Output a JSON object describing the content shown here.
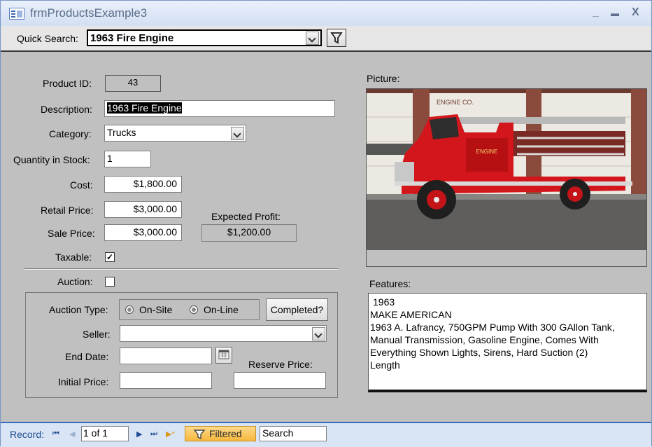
{
  "window": {
    "title": "frmProductsExample3",
    "minimize": "_",
    "maximize": "▬",
    "close": "X"
  },
  "quick_search": {
    "label": "Quick Search:",
    "value": "1963 Fire Engine"
  },
  "form": {
    "product_id": {
      "label": "Product ID:",
      "value": "43"
    },
    "description": {
      "label": "Description:",
      "value": "1963 Fire Engine"
    },
    "category": {
      "label": "Category:",
      "value": "Trucks"
    },
    "quantity": {
      "label": "Quantity in Stock:",
      "value": "1"
    },
    "cost": {
      "label": "Cost:",
      "value": "$1,800.00"
    },
    "retail_price": {
      "label": "Retail Price:",
      "value": "$3,000.00"
    },
    "sale_price": {
      "label": "Sale Price:",
      "value": "$3,000.00"
    },
    "expected_profit": {
      "label": "Expected Profit:",
      "value": "$1,200.00"
    },
    "taxable": {
      "label": "Taxable:",
      "checked": true,
      "mark": "✓"
    },
    "auction": {
      "label": "Auction:",
      "checked": false
    }
  },
  "auction": {
    "type_label": "Auction Type:",
    "options": [
      "On-Site",
      "On-Line"
    ],
    "completed_button": "Completed?",
    "seller_label": "Seller:",
    "seller_value": "",
    "end_date_label": "End Date:",
    "end_date_value": "",
    "reserve_price_label": "Reserve Price:",
    "reserve_price_value": "",
    "initial_price_label": "Initial Price:",
    "initial_price_value": ""
  },
  "picture": {
    "label": "Picture:",
    "door_text": "ENGINE CO.",
    "truck_text": "ENGINE"
  },
  "features": {
    "label": "Features:",
    "lines": [
      "1963",
      "MAKE AMERICAN",
      "1963  A. Lafrancy, 750GPM Pump With 300 GAllon Tank,",
      "Manual Transmission, Gasoline Engine, Comes With",
      "Everything Shown Lights, Sirens, Hard Suction (2)",
      "Length"
    ]
  },
  "statusbar": {
    "record_label": "Record:",
    "position": "1 of 1",
    "filter_label": "Filtered",
    "search_label": "Search",
    "nav_first": "⏮",
    "nav_prev": "◀",
    "nav_next": "▶",
    "nav_last": "⏭",
    "nav_new": "▶*"
  }
}
